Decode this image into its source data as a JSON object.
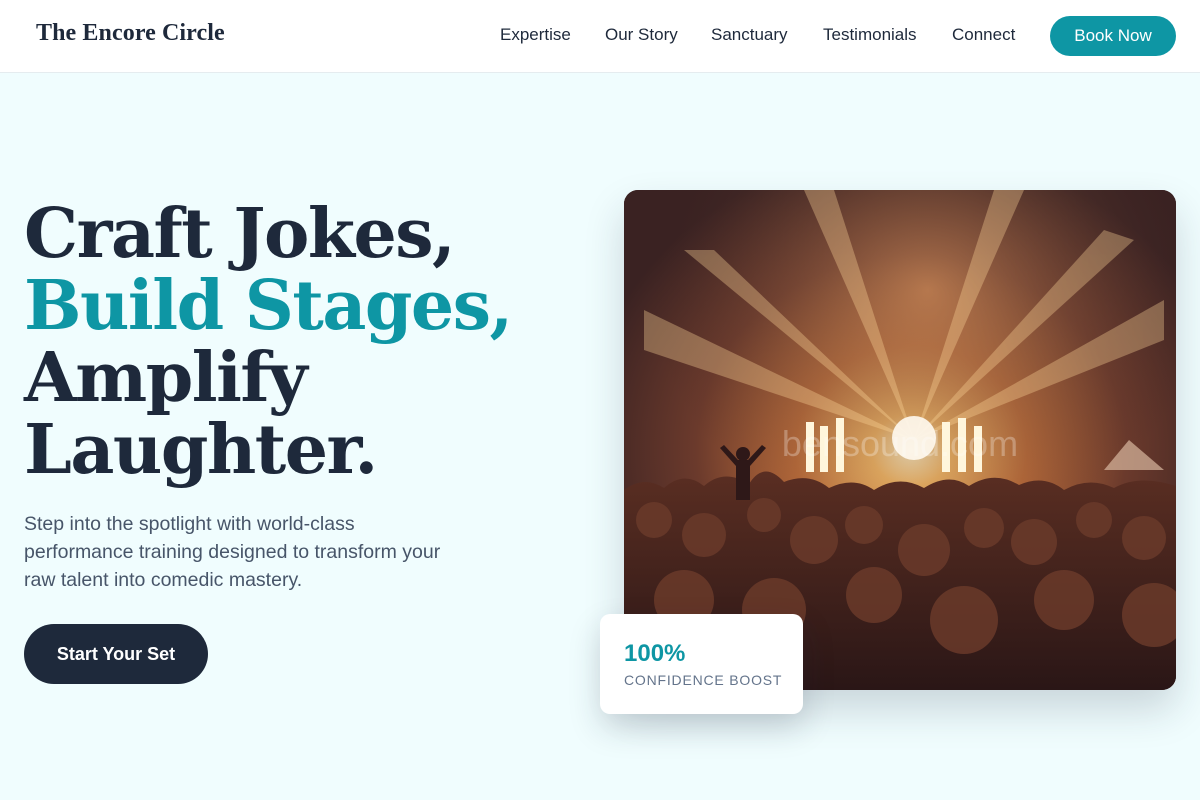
{
  "brand": {
    "name": "The Encore Circle"
  },
  "nav": {
    "items": [
      {
        "label": "Expertise"
      },
      {
        "label": "Our Story"
      },
      {
        "label": "Sanctuary"
      },
      {
        "label": "Testimonials"
      },
      {
        "label": "Connect"
      }
    ],
    "cta_label": "Book Now"
  },
  "hero": {
    "headline": {
      "line1": "Craft Jokes,",
      "line2": "Build Stages,",
      "line3": "Amplify",
      "line4": "Laughter."
    },
    "subtext": "Step into the spotlight with world-class performance training designed to transform your raw talent into comedic mastery.",
    "cta_label": "Start Your Set",
    "image_alt": "concert-crowd-photo",
    "watermark": "bensound.com"
  },
  "stat": {
    "value": "100%",
    "label": "CONFIDENCE BOOST"
  },
  "colors": {
    "accent": "#0e96a4",
    "dark": "#1e293b",
    "background": "#f0fdfe"
  }
}
